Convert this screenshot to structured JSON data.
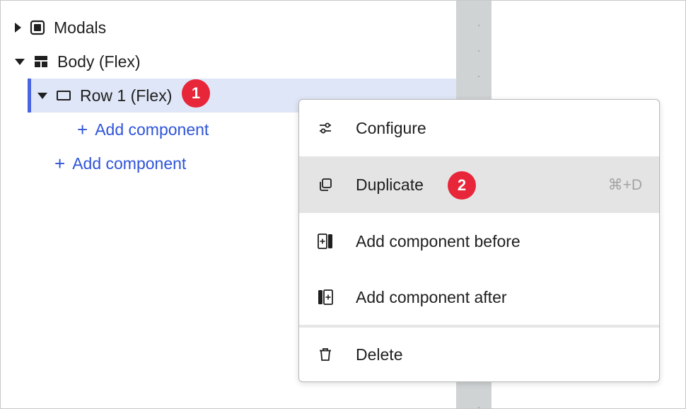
{
  "tree": {
    "modals": {
      "label": "Modals"
    },
    "body": {
      "label": "Body (Flex)"
    },
    "row1": {
      "label": "Row 1 (Flex)",
      "badge": "1"
    },
    "row1_add": {
      "label": "Add component"
    },
    "body_add": {
      "label": "Add component"
    }
  },
  "context_menu": {
    "items": [
      {
        "label": "Configure",
        "icon": "sliders-icon",
        "shortcut": ""
      },
      {
        "label": "Duplicate",
        "icon": "duplicate-icon",
        "shortcut": "⌘+D",
        "badge": "2"
      },
      {
        "label": "Add component before",
        "icon": "add-before-icon",
        "shortcut": ""
      },
      {
        "label": "Add component after",
        "icon": "add-after-icon",
        "shortcut": ""
      },
      {
        "label": "Delete",
        "icon": "trash-icon",
        "shortcut": ""
      }
    ]
  },
  "colors": {
    "accent": "#4a64e0",
    "link": "#2f54d9",
    "badge": "#e8263a",
    "selected_bg": "#dfe6f7",
    "hover_bg": "#e4e4e4"
  }
}
